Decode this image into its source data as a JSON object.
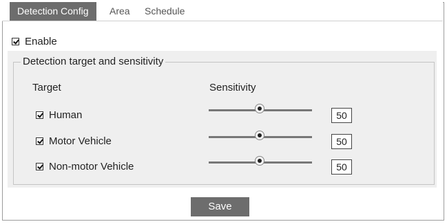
{
  "tabs": [
    {
      "label": "Detection Config",
      "active": true
    },
    {
      "label": "Area",
      "active": false
    },
    {
      "label": "Schedule",
      "active": false
    }
  ],
  "enable": {
    "label": "Enable",
    "checked": true
  },
  "group": {
    "title": "Detection target and sensitivity",
    "col_target": "Target",
    "col_sensitivity": "Sensitivity",
    "rows": [
      {
        "label": "Human",
        "checked": true,
        "sensitivity": "50"
      },
      {
        "label": "Motor Vehicle",
        "checked": true,
        "sensitivity": "50"
      },
      {
        "label": "Non-motor Vehicle",
        "checked": true,
        "sensitivity": "50"
      }
    ]
  },
  "save_label": "Save",
  "icons": {
    "checkbox": "checkmark-icon",
    "slider_thumb": "slider-thumb"
  },
  "colors": {
    "active_tab": "#6d6d6d",
    "panel": "#efefef",
    "button": "#6d6d6d"
  }
}
